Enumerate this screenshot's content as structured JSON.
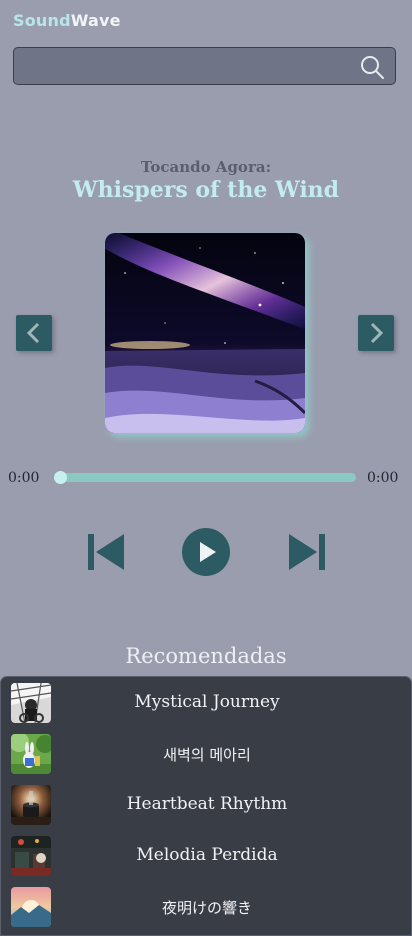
{
  "app": {
    "name_part1": "Sound",
    "name_part2": "Wave"
  },
  "search": {
    "value": "",
    "placeholder": ""
  },
  "player": {
    "now_playing_label": "Tocando Agora:",
    "title": "Whispers of the Wind",
    "current_time": "0:00",
    "total_time": "0:00",
    "progress": 0
  },
  "recommended": {
    "heading": "Recomendadas",
    "items": [
      {
        "title": "Mystical Journey"
      },
      {
        "title": "새벽의 메아리"
      },
      {
        "title": "Heartbeat Rhythm"
      },
      {
        "title": "Melodia Perdida"
      },
      {
        "title": "夜明けの響き"
      }
    ]
  },
  "icons": {
    "search": "search-icon",
    "prev_art": "chevron-left-icon",
    "next_art": "chevron-right-icon",
    "skip_back": "skip-back-icon",
    "play": "play-icon",
    "skip_forward": "skip-forward-icon"
  },
  "colors": {
    "background": "#9a9dae",
    "accent": "#2d5b63",
    "title": "#c2ecee",
    "progress": "#8bc9c3",
    "panel": "#393d45"
  }
}
